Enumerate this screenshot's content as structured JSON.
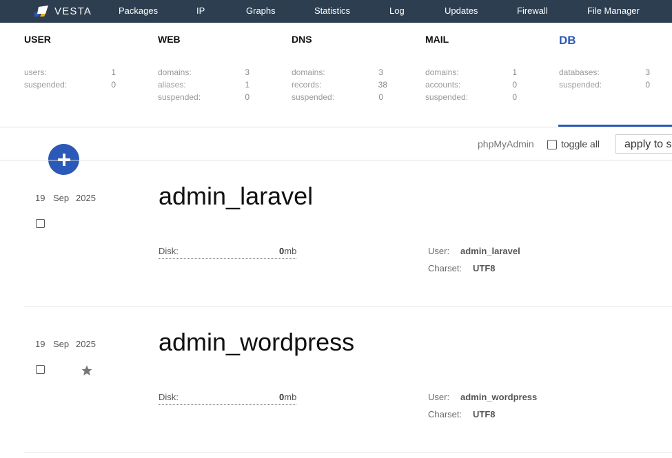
{
  "app": {
    "logo_text": "VESTA",
    "nav": [
      "Packages",
      "IP",
      "Graphs",
      "Statistics",
      "Log",
      "Updates",
      "Firewall",
      "File Manager"
    ]
  },
  "stats": {
    "user": {
      "title": "USER",
      "rows": [
        {
          "label": "users:",
          "value": "1"
        },
        {
          "label": "suspended:",
          "value": "0"
        }
      ]
    },
    "web": {
      "title": "WEB",
      "rows": [
        {
          "label": "domains:",
          "value": "3"
        },
        {
          "label": "aliases:",
          "value": "1"
        },
        {
          "label": "suspended:",
          "value": "0"
        }
      ]
    },
    "dns": {
      "title": "DNS",
      "rows": [
        {
          "label": "domains:",
          "value": "3"
        },
        {
          "label": "records:",
          "value": "38"
        },
        {
          "label": "suspended:",
          "value": "0"
        }
      ]
    },
    "mail": {
      "title": "MAIL",
      "rows": [
        {
          "label": "domains:",
          "value": "1"
        },
        {
          "label": "accounts:",
          "value": "0"
        },
        {
          "label": "suspended:",
          "value": "0"
        }
      ]
    },
    "db": {
      "title": "DB",
      "rows": [
        {
          "label": "databases:",
          "value": "3"
        },
        {
          "label": "suspended:",
          "value": "0"
        }
      ]
    }
  },
  "toolbar": {
    "phpmyadmin_label": "phpMyAdmin",
    "toggle_all_label": "toggle all",
    "apply_label": "apply to selected"
  },
  "databases": [
    {
      "day": "19",
      "month": "Sep",
      "year": "2025",
      "name": "admin_laravel",
      "disk_label": "Disk:",
      "disk_value": "0",
      "disk_unit": "mb",
      "user_label": "User:",
      "user": "admin_laravel",
      "charset_label": "Charset:",
      "charset": "UTF8",
      "starred": false
    },
    {
      "day": "19",
      "month": "Sep",
      "year": "2025",
      "name": "admin_wordpress",
      "disk_label": "Disk:",
      "disk_value": "0",
      "disk_unit": "mb",
      "user_label": "User:",
      "user": "admin_wordpress",
      "charset_label": "Charset:",
      "charset": "UTF8",
      "starred": true
    }
  ],
  "colors": {
    "nav_bg": "#2d3e50",
    "accent": "#2c59b7"
  }
}
